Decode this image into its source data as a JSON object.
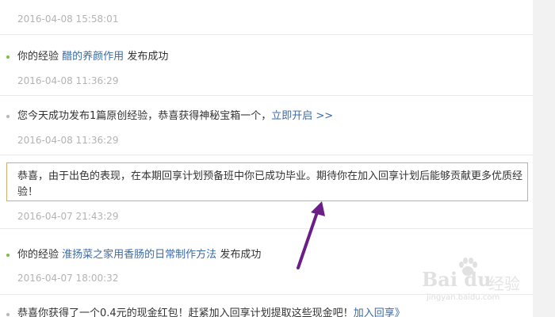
{
  "messages": [
    {
      "time": "2016-04-08 15:58:01"
    },
    {
      "prefix": "你的经验",
      "link": "醋的养颜作用",
      "suffix": "发布成功",
      "time": "2016-04-08 11:36:29"
    },
    {
      "text": "您今天成功发布1篇原创经验，恭喜获得神秘宝箱一个，",
      "link": "立即开启 >>",
      "time": "2016-04-08 11:36:29"
    },
    {
      "text": "恭喜，由于出色的表现，在本期回享计划预备班中你已成功毕业。期待你在加入回享计划后能够贡献更多优质经验！",
      "time": "2016-04-07 21:43:29"
    },
    {
      "prefix": "你的经验",
      "link": "淮扬菜之家用香肠的日常制作方法",
      "suffix": "发布成功",
      "time": "2016-04-07 18:00:32"
    },
    {
      "text": "恭喜你获得了一个0.4元的现金红包！赶紧加入回享计划提取这些现金吧！",
      "link": "加入回享》"
    }
  ],
  "watermark": {
    "brand": "Bai du",
    "brand_cn": "经验",
    "url": "jingyan.baidu.com"
  },
  "colors": {
    "link": "#3b6aa6",
    "highlight_border": "#d8aa6c",
    "arrow": "#6a1e86",
    "bullet_green": "#7cc040",
    "time": "#b3b3b3"
  }
}
